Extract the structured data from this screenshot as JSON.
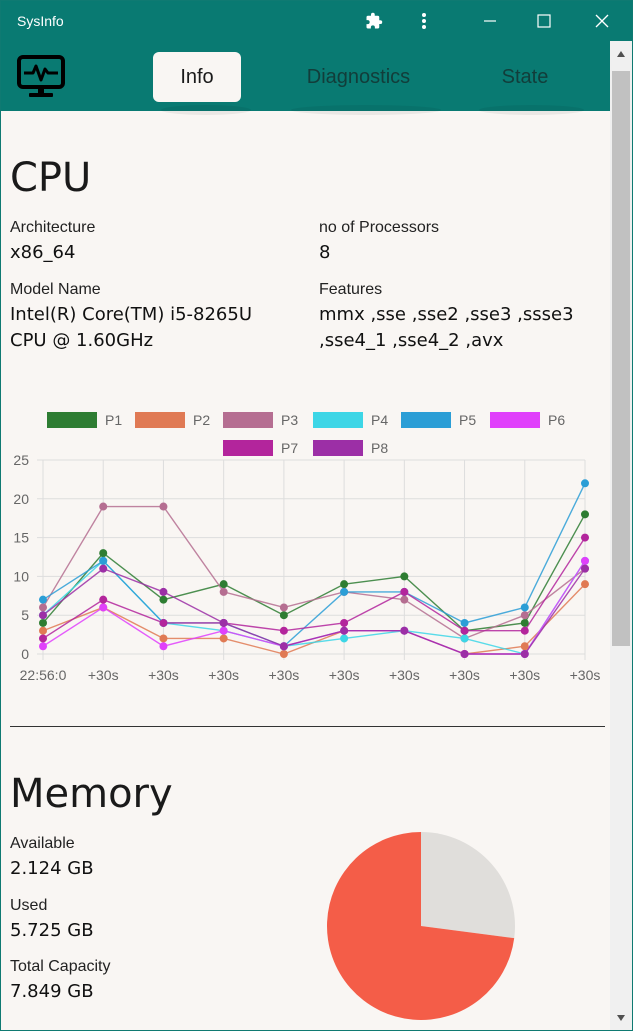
{
  "window": {
    "title": "SysInfo",
    "icons": [
      "puzzle-icon",
      "more-vert-icon",
      "minimize-icon",
      "maximize-icon",
      "close-icon"
    ],
    "accent": "#097a72"
  },
  "nav": {
    "tabs": [
      {
        "label": "Info",
        "active": true
      },
      {
        "label": "Diagnostics",
        "active": false
      },
      {
        "label": "State",
        "active": false
      }
    ]
  },
  "cpu": {
    "heading": "CPU",
    "architecture_label": "Architecture",
    "architecture_value": "x86_64",
    "processors_label": "no of Processors",
    "processors_value": "8",
    "model_label": "Model Name",
    "model_value_1": "Intel(R) Core(TM) i5-8265U",
    "model_value_2": "CPU @ 1.60GHz",
    "features_label": "Features",
    "features_value_1": "mmx ,sse ,sse2 ,sse3 ,ssse3",
    "features_value_2": ",sse4_1 ,sse4_2 ,avx"
  },
  "chart_data": {
    "type": "line",
    "x": [
      "22:56:0",
      "+30s",
      "+30s",
      "+30s",
      "+30s",
      "+30s",
      "+30s",
      "+30s",
      "+30s",
      "+30s"
    ],
    "ylim": [
      0,
      25
    ],
    "yticks": [
      0,
      5,
      10,
      15,
      20,
      25
    ],
    "grid": true,
    "legend": "top",
    "series": [
      {
        "name": "P1",
        "color": "#2e7d32",
        "values": [
          4,
          13,
          7,
          9,
          5,
          9,
          10,
          3,
          4,
          18
        ]
      },
      {
        "name": "P2",
        "color": "#e07a54",
        "values": [
          3,
          6,
          2,
          2,
          0,
          3,
          3,
          0,
          1,
          9
        ]
      },
      {
        "name": "P3",
        "color": "#b56e91",
        "values": [
          6,
          19,
          19,
          8,
          6,
          8,
          7,
          2,
          5,
          11
        ]
      },
      {
        "name": "P4",
        "color": "#3dd6e6",
        "values": [
          5,
          12,
          4,
          3,
          1,
          2,
          3,
          2,
          0,
          12
        ]
      },
      {
        "name": "P5",
        "color": "#2b9ed6",
        "values": [
          7,
          12,
          4,
          4,
          1,
          8,
          8,
          4,
          6,
          22
        ]
      },
      {
        "name": "P6",
        "color": "#e040fb",
        "values": [
          1,
          6,
          1,
          3,
          1,
          3,
          3,
          0,
          0,
          12
        ]
      },
      {
        "name": "P7",
        "color": "#b3259c",
        "values": [
          2,
          7,
          4,
          4,
          3,
          4,
          8,
          3,
          3,
          15
        ]
      },
      {
        "name": "P8",
        "color": "#9c2fa6",
        "values": [
          5,
          11,
          8,
          4,
          1,
          3,
          3,
          0,
          0,
          11
        ]
      }
    ]
  },
  "memory": {
    "heading": "Memory",
    "available_label": "Available",
    "available_value": "2.124 GB",
    "used_label": "Used",
    "used_value": "5.725 GB",
    "total_label": "Total Capacity",
    "total_value": "7.849 GB",
    "pie": {
      "used_fraction": 0.7294,
      "used_color": "#f45d48",
      "free_color": "#e0dedb"
    }
  }
}
